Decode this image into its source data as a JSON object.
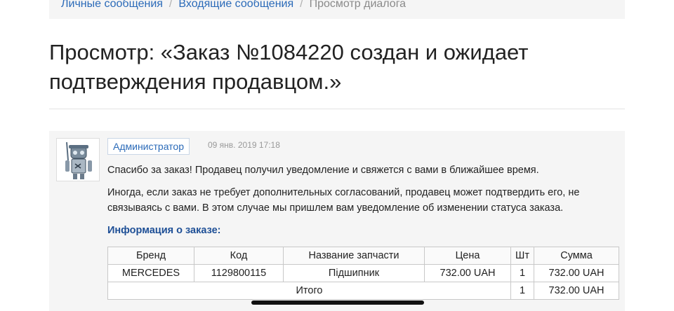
{
  "breadcrumb": {
    "items": [
      "Личные сообщения",
      "Входящие сообщения"
    ],
    "separator": "/",
    "active": "Просмотр диалога"
  },
  "page": {
    "title": "Просмотр: «Заказ №1084220 создан и ожидает подтверждения продавцом.»"
  },
  "message": {
    "author": "Администратор",
    "date": "09 янв. 2019 17:18",
    "paragraph1": "Спасибо за заказ! Продавец получил уведомление и свяжется с вами в ближайшее время.",
    "paragraph2": "Иногда, если заказ не требует дополнительных согласований, продавец может подтвердить его, не связываясь с вами. В этом случае мы пришлем вам уведомление об изменении статуса заказа.",
    "avatar_icon": "robot-icon"
  },
  "order_info": {
    "title": "Информация о заказе:",
    "columns": {
      "brand": "Бренд",
      "code": "Код",
      "name": "Название запчасти",
      "price": "Цена",
      "qty": "Шт",
      "sum": "Сумма"
    },
    "row": {
      "brand": "MERCEDES",
      "code": "1129800115",
      "name": "Підшипник",
      "price": "732.00 UAH",
      "qty": "1",
      "sum": "732.00 UAH"
    },
    "total": {
      "label": "Итого",
      "qty": "1",
      "sum": "732.00 UAH"
    }
  },
  "colors": {
    "link": "#2a6ab8",
    "info_title": "#1e4f96",
    "panel_bg": "#f5f5f5"
  }
}
